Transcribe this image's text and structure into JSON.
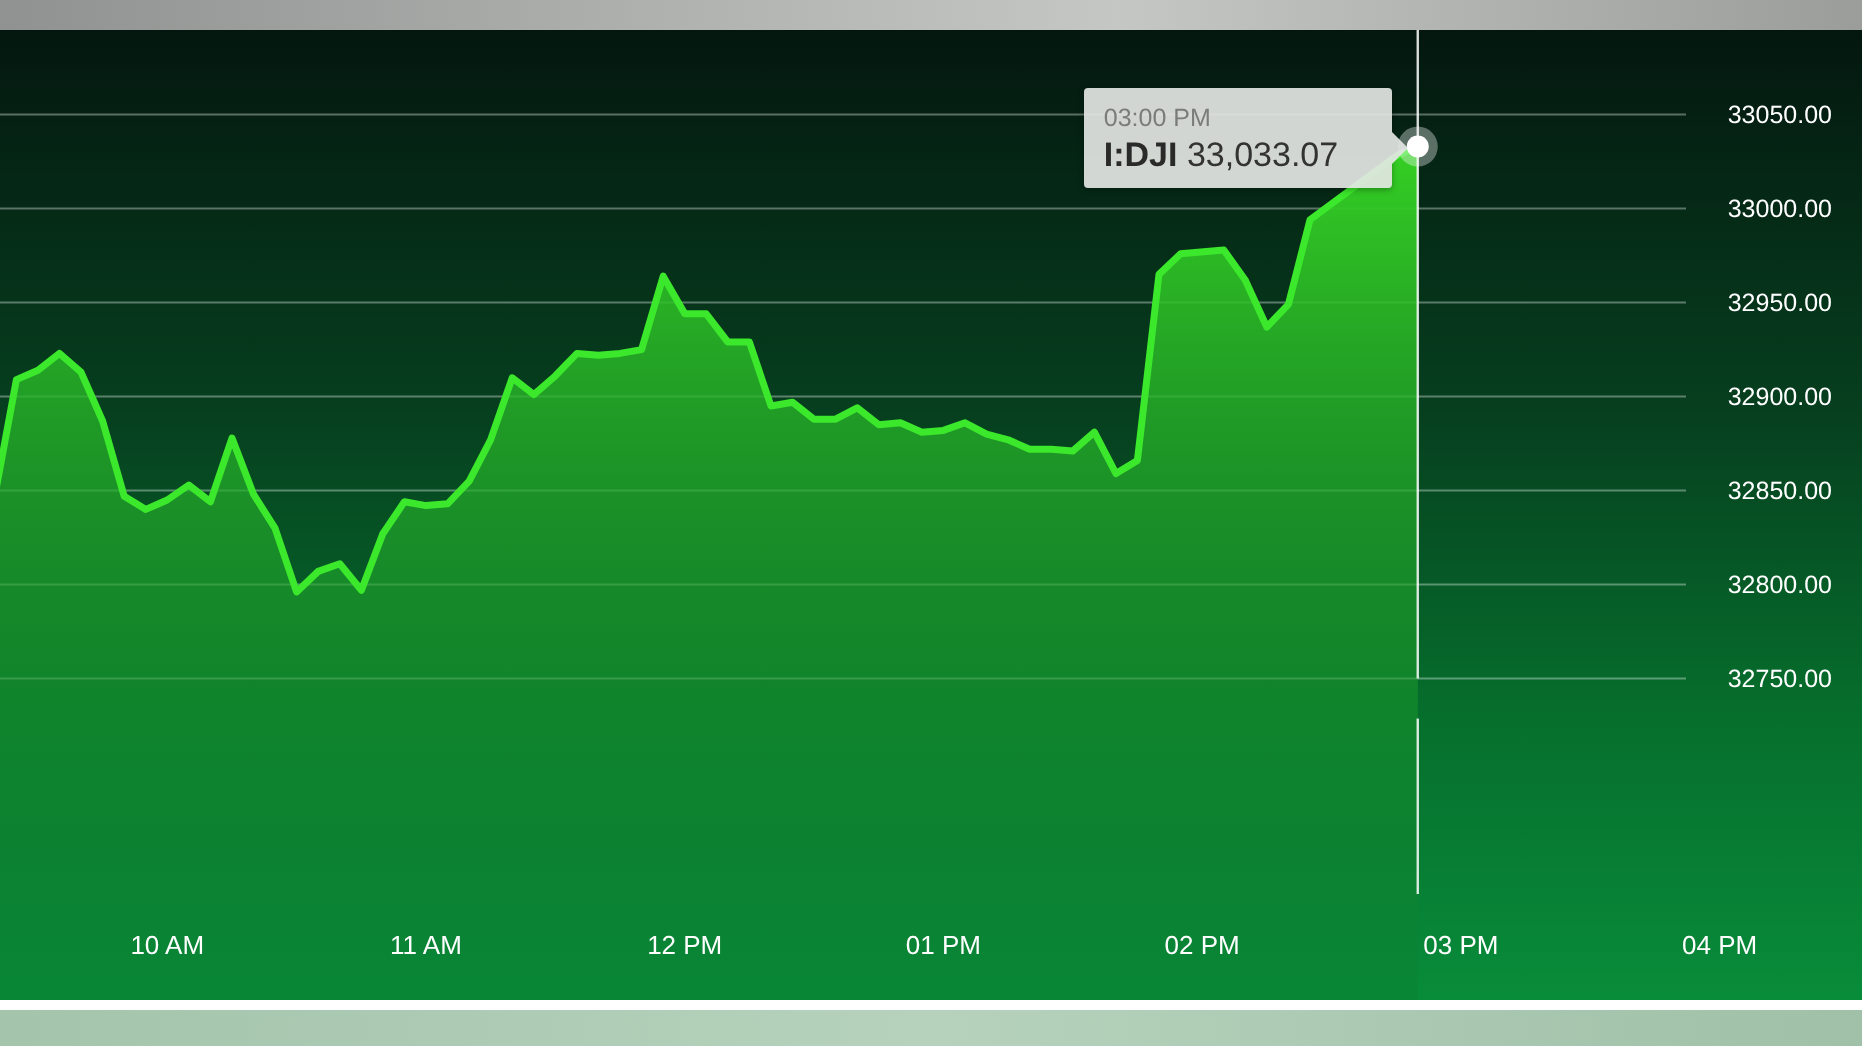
{
  "chart": {
    "chart_data": {
      "type": "area",
      "grid": true,
      "categories": [
        null,
        null,
        null,
        null,
        null,
        null,
        null,
        null,
        "10 AM",
        null,
        null,
        null,
        null,
        null,
        null,
        null,
        null,
        null,
        null,
        null,
        "11 AM",
        null,
        null,
        null,
        null,
        null,
        null,
        null,
        null,
        null,
        null,
        null,
        "12 PM",
        null,
        null,
        null,
        null,
        null,
        null,
        null,
        null,
        null,
        null,
        null,
        "01 PM",
        null,
        null,
        null,
        null,
        null,
        null,
        null,
        null,
        null,
        null,
        null,
        "02 PM",
        null,
        null,
        null,
        null,
        null,
        null,
        null,
        null,
        null,
        null,
        null,
        "03 PM",
        null,
        null,
        null,
        null,
        null,
        null,
        null,
        null,
        null,
        null,
        null,
        "04 PM"
      ],
      "series": [
        {
          "name": "I:DJI",
          "color": "#3be82b",
          "values": [
            32847,
            32909,
            32914,
            32923,
            32913,
            32887,
            32847,
            32840,
            32845,
            32853,
            32844,
            32878,
            32848,
            32830,
            32796,
            32807,
            32811,
            32797,
            32827,
            32844,
            32842,
            32843,
            32855,
            32877,
            32910,
            32901,
            32911,
            32923,
            32922,
            32923,
            32925,
            32964,
            32944,
            32944,
            32929,
            32929,
            32895,
            32897,
            32888,
            32888,
            32894,
            32885,
            32886,
            32881,
            32882,
            32886,
            32880,
            32877,
            32872,
            32872,
            32871,
            32881,
            32859,
            32866,
            32965,
            32976,
            null,
            32978,
            32962,
            32937,
            32949,
            32994,
            null,
            null,
            null,
            33028,
            33033,
            null,
            null,
            null,
            null,
            null,
            null,
            null,
            null,
            null,
            null,
            null,
            null,
            null,
            null
          ]
        }
      ],
      "ylim": [
        32579,
        33095
      ],
      "yticks": [
        {
          "value": 33050,
          "label": "33050.00"
        },
        {
          "value": 33000,
          "label": "33000.00"
        },
        {
          "value": 32950,
          "label": "32950.00"
        },
        {
          "value": 32900,
          "label": "32900.00"
        },
        {
          "value": 32850,
          "label": "32850.00"
        },
        {
          "value": 32800,
          "label": "32800.00"
        },
        {
          "value": 32750,
          "label": "32750.00"
        }
      ]
    },
    "tooltip": {
      "time": "03:00 PM",
      "value": "33,033.07"
    }
  }
}
